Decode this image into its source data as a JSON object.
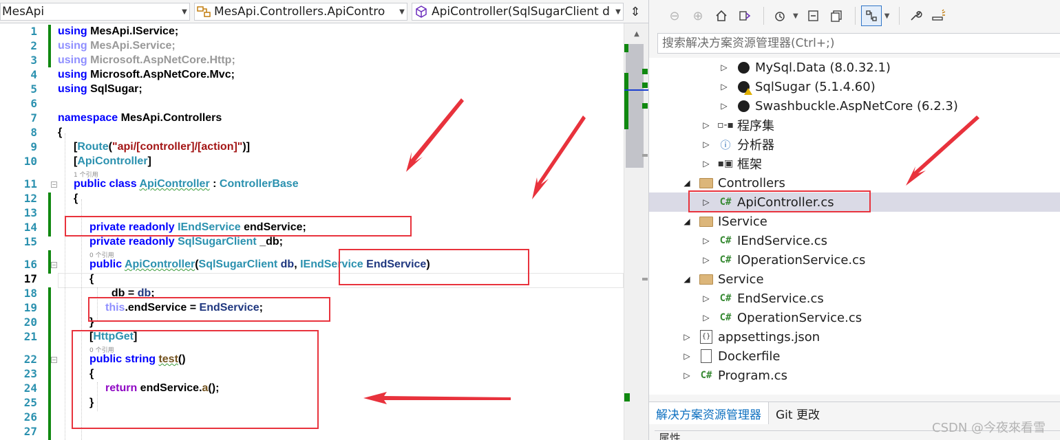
{
  "editor": {
    "nav": {
      "project": "MesApi",
      "class_path": "MesApi.Controllers.ApiContro",
      "member": "ApiController(SqlSugarClient d"
    },
    "line_numbers": [
      "1",
      "2",
      "3",
      "4",
      "5",
      "6",
      "7",
      "8",
      "9",
      "10",
      "11",
      "12",
      "13",
      "14",
      "15",
      "16",
      "17",
      "18",
      "19",
      "20",
      "21",
      "22",
      "23",
      "24",
      "25",
      "26",
      "27"
    ],
    "code": {
      "l1_kw": "using",
      "l1_rest": " MesApi.IService;",
      "l2_kw": "using",
      "l2_rest": " MesApi.Service;",
      "l3_kw": "using",
      "l3_rest": " Microsoft.AspNetCore.Http;",
      "l4_kw": "using",
      "l4_rest": " Microsoft.AspNetCore.Mvc;",
      "l5_kw": "using",
      "l5_rest": " SqlSugar;",
      "l7_kw": "namespace",
      "l7_rest": " MesApi.Controllers",
      "l8": "{",
      "l9_a": "[",
      "l9_attr": "Route",
      "l9_b": "(",
      "l9_str": "\"api/[controller]/[action]\"",
      "l9_c": ")]",
      "l10_a": "[",
      "l10_attr": "ApiController",
      "l10_b": "]",
      "lens_10": "1 个引用",
      "l11_kw": "public class",
      "l11_sp": " ",
      "l11_name": "ApiController",
      "l11_colon": " : ",
      "l11_base": "ControllerBase",
      "l12": "{",
      "l14_kw": "private readonly",
      "l14_sp": " ",
      "l14_type": "IEndService",
      "l14_rest": " endService;",
      "l15_kw": "private readonly",
      "l15_sp": " ",
      "l15_type": "SqlSugarClient",
      "l15_rest": " _db;",
      "lens_15": "0 个引用",
      "l16_kw": "public",
      "l16_sp": " ",
      "l16_name": "ApiController",
      "l16_p1": "(",
      "l16_t1": "SqlSugarClient",
      "l16_v1": " db",
      "l16_comma": ", ",
      "l16_t2": "IEndService",
      "l16_v2": " EndService",
      "l16_p2": ")",
      "l17": "{",
      "l18_a": "_db = ",
      "l18_v": "db",
      "l18_b": ";",
      "l19_this": "this",
      "l19_a": ".endService = ",
      "l19_v": "EndService",
      "l19_b": ";",
      "l20": "}",
      "l21_a": "[",
      "l21_attr": "HttpGet",
      "l21_b": "]",
      "lens_21": "0 个引用",
      "l22_kw": "public string",
      "l22_sp": " ",
      "l22_name": "test",
      "l22_p": "()",
      "l23": "{",
      "l24_kw": "return",
      "l24_a": " endService.",
      "l24_m": "a",
      "l24_b": "();",
      "l25": "}"
    }
  },
  "solution_explorer": {
    "search_placeholder": "搜索解决方案资源管理器(Ctrl+;)",
    "tree": [
      {
        "label": "MySql.Data (8.0.32.1)",
        "icon": "package-icon"
      },
      {
        "label": "SqlSugar (5.1.4.60)",
        "icon": "package-warning-icon"
      },
      {
        "label": "Swashbuckle.AspNetCore (6.2.3)",
        "icon": "package-icon"
      },
      {
        "label": "程序集",
        "icon": "assembly-icon"
      },
      {
        "label": "分析器",
        "icon": "analyzer-icon"
      },
      {
        "label": "框架",
        "icon": "framework-icon"
      },
      {
        "label": "Controllers",
        "icon": "folder-icon"
      },
      {
        "label": "ApiController.cs",
        "icon": "csharp-file-icon"
      },
      {
        "label": "IService",
        "icon": "folder-icon"
      },
      {
        "label": "IEndService.cs",
        "icon": "csharp-file-icon"
      },
      {
        "label": "IOperationService.cs",
        "icon": "csharp-file-icon"
      },
      {
        "label": "Service",
        "icon": "folder-icon"
      },
      {
        "label": "EndService.cs",
        "icon": "csharp-file-icon"
      },
      {
        "label": "OperationService.cs",
        "icon": "csharp-file-icon"
      },
      {
        "label": "appsettings.json",
        "icon": "json-file-icon"
      },
      {
        "label": "Dockerfile",
        "icon": "file-icon"
      },
      {
        "label": "Program.cs",
        "icon": "csharp-file-icon"
      }
    ],
    "csharp_badge": "C#",
    "json_badge": "{}",
    "tabs": [
      "解决方案资源管理器",
      "Git 更改"
    ],
    "properties_label": "属性"
  },
  "watermark": "CSDN @今夜來看雪",
  "colors": {
    "annotation": "#e8323c",
    "change_marker": "#108810",
    "selection": "#dadae6"
  }
}
